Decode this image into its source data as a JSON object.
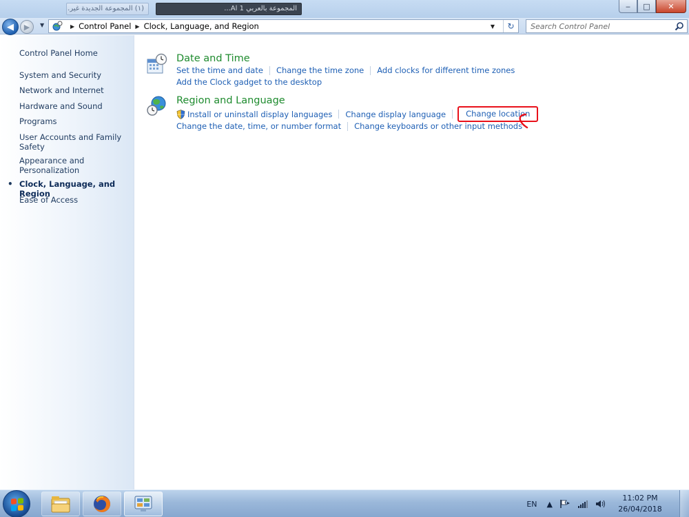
{
  "window": {
    "tab_items": [
      "(١) المجموعة الجديدة غير...",
      "المجموعة بالعربي 1 Al..."
    ],
    "controls": {
      "minimize": "‒",
      "maximize": "□",
      "close": "✕"
    }
  },
  "nav": {
    "back_icon": "back-arrow-icon",
    "forward_icon": "forward-arrow-icon",
    "breadcrumb": [
      "Control Panel",
      "Clock, Language, and Region"
    ],
    "search_placeholder": "Search Control Panel"
  },
  "sidebar": {
    "home": "Control Panel Home",
    "items": [
      {
        "label": "System and Security"
      },
      {
        "label": "Network and Internet"
      },
      {
        "label": "Hardware and Sound"
      },
      {
        "label": "Programs"
      },
      {
        "label": "User Accounts and Family Safety"
      },
      {
        "label": "Appearance and Personalization"
      },
      {
        "label": "Clock, Language, and Region",
        "current": true
      },
      {
        "label": "Ease of Access"
      }
    ]
  },
  "sections": {
    "date_time": {
      "title": "Date and Time",
      "icon": "calendar-clock-icon",
      "links_row1": [
        "Set the time and date",
        "Change the time zone",
        "Add clocks for different time zones"
      ],
      "links_row2": [
        "Add the Clock gadget to the desktop"
      ]
    },
    "region_language": {
      "title": "Region and Language",
      "icon": "globe-clock-icon",
      "links_row1": [
        "Install or uninstall display languages",
        "Change display language",
        "Change location"
      ],
      "links_row2": [
        "Change the date, time, or number format",
        "Change keyboards or other input methods"
      ],
      "highlighted": "Change location"
    }
  },
  "taskbar": {
    "apps": [
      "file-explorer-icon",
      "firefox-icon",
      "control-panel-icon"
    ],
    "lang": "EN",
    "time": "11:02 PM",
    "date": "26/04/2018"
  },
  "colors": {
    "link": "#1e5fb4",
    "section_title": "#1e8b2e",
    "highlight": "#e8101a"
  }
}
